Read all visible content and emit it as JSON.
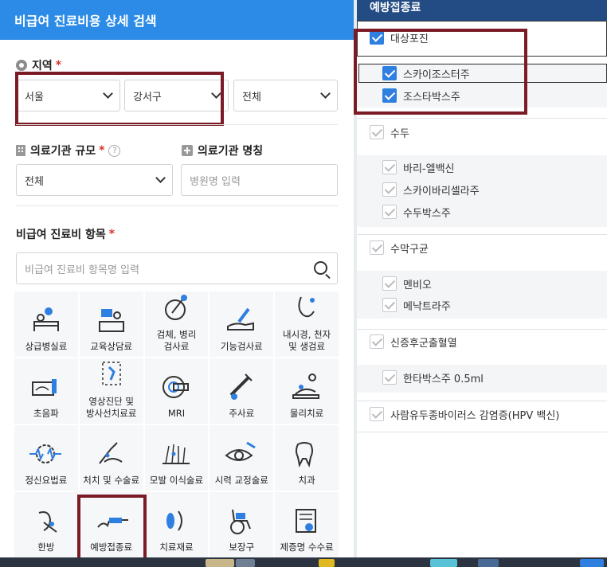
{
  "header": {
    "title": "비급여 진료비용 상세 검색"
  },
  "region": {
    "label": "지역",
    "required_mark": "*",
    "sido": "서울",
    "sigungu": "강서구",
    "dong": "전체"
  },
  "facility": {
    "scale_label": "의료기관 규모",
    "required_mark": "*",
    "help_glyph": "?",
    "scale_value": "전체",
    "name_label": "의료기관 명칭",
    "name_placeholder": "병원명 입력"
  },
  "items": {
    "label": "비급여 진료비 항목",
    "required_mark": "*",
    "search_placeholder": "비급여 진료비 항목명 입력"
  },
  "categories": [
    {
      "label": "상급병실료",
      "icon": "hospital-bed-icon"
    },
    {
      "label": "교육상담료",
      "icon": "counseling-icon"
    },
    {
      "label": "검체, 병리\n검사료",
      "icon": "specimen-icon"
    },
    {
      "label": "기능검사료",
      "icon": "function-test-icon"
    },
    {
      "label": "내시경, 천자\n및 생검료",
      "icon": "endoscope-icon"
    },
    {
      "label": "초음파",
      "icon": "ultrasound-icon"
    },
    {
      "label": "영상진단 및\n방사선치료료",
      "icon": "radiology-icon"
    },
    {
      "label": "MRI",
      "icon": "mri-icon"
    },
    {
      "label": "주사료",
      "icon": "syringe-icon"
    },
    {
      "label": "물리치료",
      "icon": "physical-therapy-icon"
    },
    {
      "label": "정신요법료",
      "icon": "brain-icon"
    },
    {
      "label": "처치 및 수술료",
      "icon": "surgery-icon"
    },
    {
      "label": "모발 이식술료",
      "icon": "hair-transplant-icon"
    },
    {
      "label": "시력 교정술료",
      "icon": "eye-icon"
    },
    {
      "label": "치과",
      "icon": "tooth-icon"
    },
    {
      "label": "한방",
      "icon": "acupuncture-icon"
    },
    {
      "label": "예방접종료",
      "icon": "vaccine-icon"
    },
    {
      "label": "치료재료",
      "icon": "material-icon"
    },
    {
      "label": "보장구",
      "icon": "wheelchair-icon"
    },
    {
      "label": "제증명 수수료",
      "icon": "certificate-icon"
    }
  ],
  "vaccine_panel": {
    "title": "예방접종료",
    "groups": [
      {
        "label": "대상포진",
        "checked": true,
        "children": [
          {
            "label": "스카이조스터주",
            "checked": true
          },
          {
            "label": "조스타박스주",
            "checked": true
          }
        ]
      },
      {
        "label": "수두",
        "checked": false,
        "children": [
          {
            "label": "바리-엘백신",
            "checked": false
          },
          {
            "label": "스카이바리셀라주",
            "checked": false
          },
          {
            "label": "수두박스주",
            "checked": false
          }
        ]
      },
      {
        "label": "수막구균",
        "checked": false,
        "children": [
          {
            "label": "멘비오",
            "checked": false
          },
          {
            "label": "메낙트라주",
            "checked": false
          }
        ]
      },
      {
        "label": "신증후군출혈열",
        "checked": false,
        "children": [
          {
            "label": "한타박스주 0.5ml",
            "checked": false
          }
        ]
      },
      {
        "label": "사람유두종바이러스 감염증(HPV 백신)",
        "checked": false,
        "children": []
      }
    ]
  },
  "colors": {
    "header": "#2b8be6",
    "panel_header": "#234c84",
    "checkbox_on": "#2f7fe0",
    "highlight": "#7b1b26",
    "required": "#d6332a"
  }
}
